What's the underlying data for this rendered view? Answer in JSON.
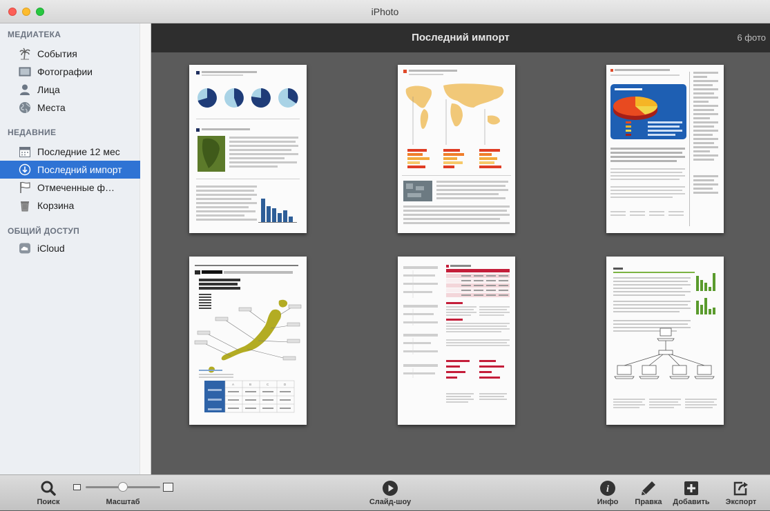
{
  "window": {
    "title": "iPhoto"
  },
  "sidebar": {
    "sections": [
      {
        "title": "МЕДИАТЕКА"
      },
      {
        "title": "НЕДАВНИЕ"
      },
      {
        "title": "ОБЩИЙ ДОСТУП"
      }
    ],
    "items": [
      {
        "label": "События",
        "icon": "palm-tree-icon"
      },
      {
        "label": "Фотографии",
        "icon": "photos-icon"
      },
      {
        "label": "Лица",
        "icon": "person-icon"
      },
      {
        "label": "Места",
        "icon": "globe-icon"
      },
      {
        "label": "Последние 12 мес",
        "icon": "calendar-icon"
      },
      {
        "label": "Последний импорт",
        "icon": "import-icon",
        "selected": true
      },
      {
        "label": "Отмеченные ф…",
        "icon": "flag-icon"
      },
      {
        "label": "Корзина",
        "icon": "trash-icon"
      },
      {
        "label": "iCloud",
        "icon": "cloud-icon"
      }
    ]
  },
  "main": {
    "title": "Последний импорт",
    "count": "6 фото",
    "thumbnails": [
      {
        "name": "pie-charts-report"
      },
      {
        "name": "world-map-report"
      },
      {
        "name": "3d-pie-report"
      },
      {
        "name": "japan-map-report"
      },
      {
        "name": "table-report"
      },
      {
        "name": "network-diagram-report"
      }
    ]
  },
  "toolbar": {
    "search_label": "Поиск",
    "zoom_label": "Масштаб",
    "zoom_level": 0.5,
    "slideshow_label": "Слайд-шоу",
    "info_label": "Инфо",
    "edit_label": "Правка",
    "add_label": "Добавить",
    "export_label": "Экспорт"
  },
  "colors": {
    "accent": "#2f73d4",
    "header_bg": "#2e2e2e",
    "grid_bg": "#5b5b5b",
    "sidebar_bg": "#eceff3"
  }
}
